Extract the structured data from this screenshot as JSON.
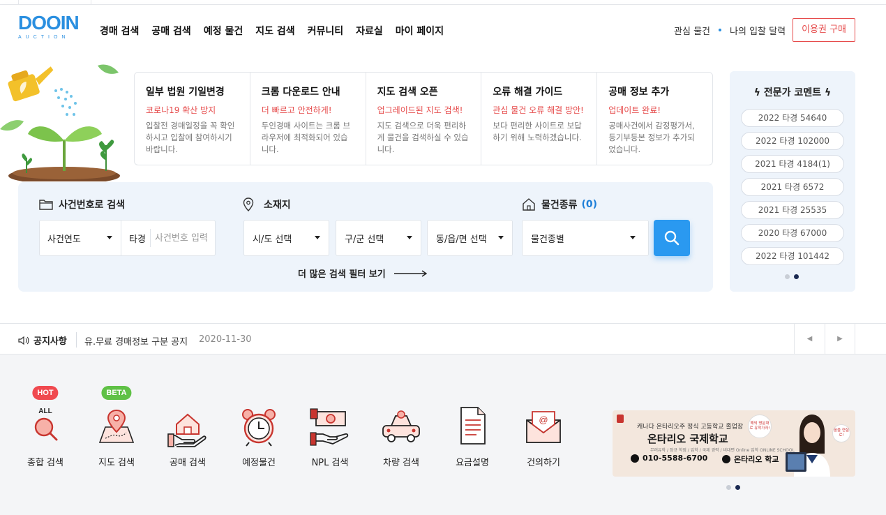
{
  "header": {
    "logo_text": "DOOIN",
    "logo_sub": "AUCTION",
    "nav": [
      "경매 검색",
      "공매 검색",
      "예정 물건",
      "지도 검색",
      "커뮤니티",
      "자료실",
      "마이 페이지"
    ],
    "util": {
      "interest": "관심 물건",
      "calendar": "나의 입찰 달력",
      "buy": "이용권 구매"
    }
  },
  "notices": [
    {
      "title": "일부 법원 기일변경",
      "sub": "코로나19 확산 방지",
      "desc": "입찰전 경매일정을 꼭 확인하시고 입찰에 참여하시기 바랍니다."
    },
    {
      "title": "크롬 다운로드 안내",
      "sub": "더 빠르고 안전하게!",
      "desc": "두인경매 사이트는 크롬 브라우저에 최적화되어 있습니다."
    },
    {
      "title": "지도 검색 오픈",
      "sub": "업그레이드된 지도 검색!",
      "desc": "지도 검색으로 더욱 편리하게 물건을 검색하실 수 있습니다."
    },
    {
      "title": "오류 해결 가이드",
      "sub": "관심 물건 오류 해결 방안!",
      "desc": "보다 편리한 사이트로 보답하기 위해 노력하겠습니다."
    },
    {
      "title": "공매 정보 추가",
      "sub": "업데이트 완료!",
      "desc": "공매사건에서 감정평가서, 등기부등본 정보가 추가되었습니다."
    }
  ],
  "search": {
    "case_label": "사건번호로 검색",
    "location_label": "소재지",
    "type_label": "물건종류",
    "type_count": "(0)",
    "year_select": "사건연도",
    "case_prefix": "타경",
    "case_placeholder": "사건번호 입력",
    "sido": "시/도 선택",
    "gugun": "구/군 선택",
    "dong": "동/읍/면 선택",
    "type_select": "물건종별",
    "more_filters": "더 많은 검색 필터 보기"
  },
  "expert": {
    "title": "전문가 코멘트",
    "items": [
      "2022 타경 54640",
      "2022 타경 102000",
      "2021 타경 4184(1)",
      "2021 타경 6572",
      "2021 타경 25535",
      "2020 타경 67000",
      "2022 타경 101442"
    ]
  },
  "notice_bar": {
    "label": "공지사항",
    "text": "유.무료 경매정보 구분 공지",
    "date": "2020-11-30"
  },
  "services": [
    {
      "name": "종합 검색",
      "badge": "HOT",
      "badge_color": "#f0494f",
      "icon": "search-all-icon",
      "icon_text": "ALL"
    },
    {
      "name": "지도 검색",
      "badge": "BETA",
      "badge_color": "#5fc146",
      "icon": "map-pin-icon"
    },
    {
      "name": "공매 검색",
      "icon": "house-hand-icon"
    },
    {
      "name": "예정물건",
      "icon": "alarm-clock-icon"
    },
    {
      "name": "NPL 검색",
      "icon": "money-hand-icon"
    },
    {
      "name": "차량 검색",
      "icon": "car-icon"
    },
    {
      "name": "요금설명",
      "icon": "document-icon"
    },
    {
      "name": "건의하기",
      "icon": "mail-icon"
    }
  ],
  "banner": {
    "line1": "캐나다 온타리오주 정식 고등학교 졸업장",
    "line2": "온타리오 국제학교",
    "line3": "무려유학 / 정규 학점 / 입학 / 국제 경력 / 비대면 Online 입학 ONLINE SCHOOL",
    "phone": "010-5588-6700",
    "channel": "온타리오 학교",
    "bubble1": "해외 명문대로 유학가자!",
    "bubble2": "꿈을 현실로!"
  },
  "colors": {
    "accent": "#2a99f0",
    "red": "#e64b4b",
    "icon_red": "#d9413a"
  }
}
